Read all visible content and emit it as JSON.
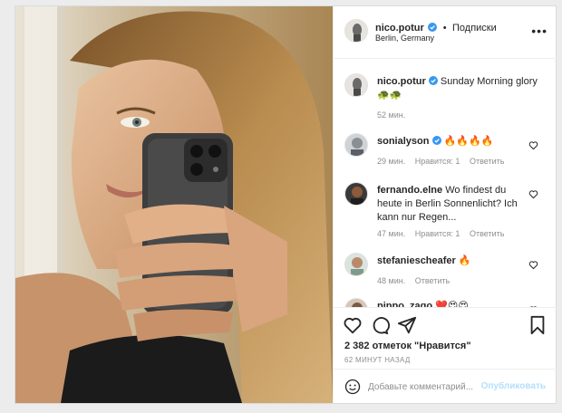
{
  "header": {
    "username": "nico.potur",
    "separator": "•",
    "follow_label": "Подписки",
    "location": "Berlin, Germany",
    "more_label": "•••"
  },
  "caption": {
    "username": "nico.potur",
    "text": "Sunday Morning glory",
    "emojis": "🐢🐢",
    "time": "52 мин."
  },
  "comments": [
    {
      "username": "sonialyson",
      "text": "🔥🔥🔥🔥",
      "time": "29 мин.",
      "likes": "Нравится: 1",
      "reply": "Ответить"
    },
    {
      "username": "fernando.elne",
      "text": "Wo findest du heute in Berlin Sonnenlicht? Ich kann nur Regen...",
      "time": "47 мин.",
      "likes": "Нравится: 1",
      "reply": "Ответить"
    },
    {
      "username": "stefaniescheafer",
      "text": "🔥",
      "time": "48 мин.",
      "reply": "Ответить"
    },
    {
      "username": "pippo_zago",
      "text": "❤️😍😍"
    }
  ],
  "stats": {
    "likes_text": "2 382 отметок \"Нравится\"",
    "posted_ago": "62 МИНУТ НАЗАД"
  },
  "comment_box": {
    "placeholder": "Добавьте комментарий...",
    "publish_label": "Опубликовать"
  },
  "colors": {
    "verified": "#3897f0",
    "publish_disabled": "#b2dffc",
    "muted": "#8e8e8e"
  },
  "icons": [
    "verified-icon",
    "heart-icon",
    "comment-icon",
    "share-icon",
    "bookmark-icon",
    "emoji-icon",
    "more-icon"
  ]
}
